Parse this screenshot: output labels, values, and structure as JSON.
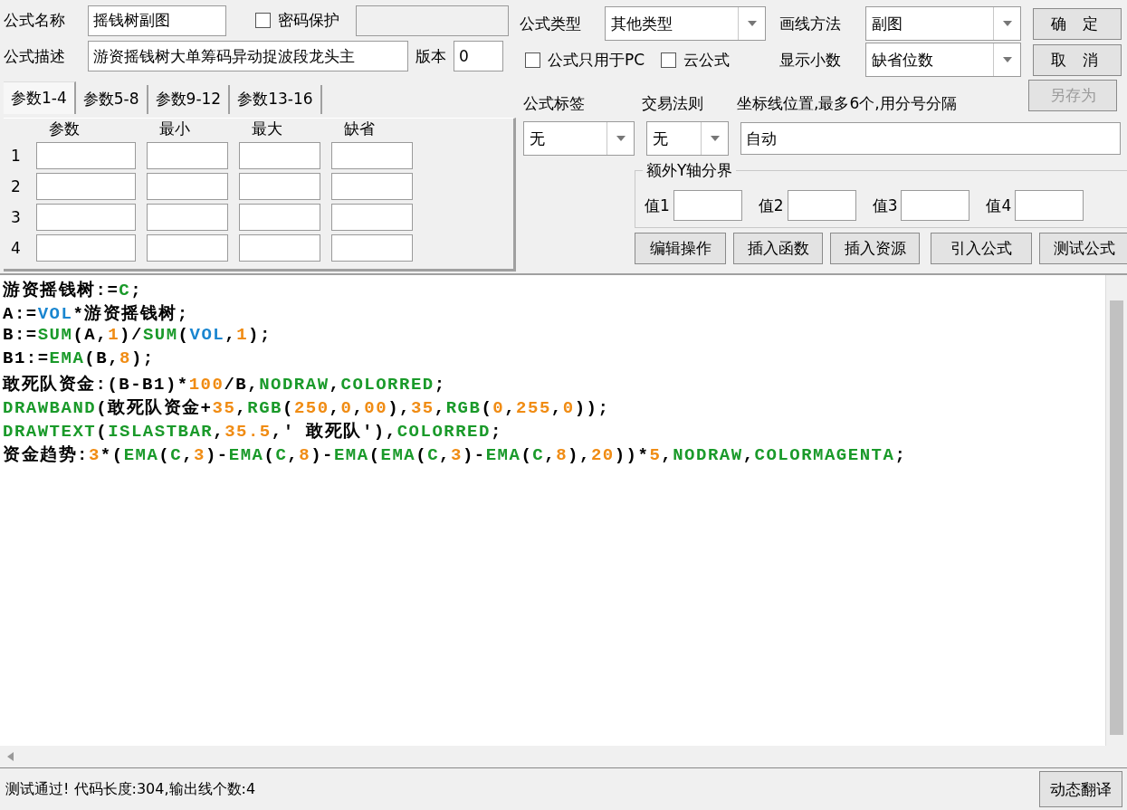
{
  "formula": {
    "name_label": "公式名称",
    "name_value": "摇钱树副图",
    "password": {
      "label": "密码保护",
      "checked": false
    },
    "password_field": {
      "disabled": true
    },
    "description_label": "公式描述",
    "description_value": "游资摇钱树大单筹码异动捉波段龙头主",
    "version_label": "版本",
    "version_value": "0"
  },
  "tabs": [
    {
      "label": "参数1-4",
      "selected": true
    },
    {
      "label": "参数5-8",
      "selected": false
    },
    {
      "label": "参数9-12",
      "selected": false
    },
    {
      "label": "参数13-16",
      "selected": false
    }
  ],
  "param_table": {
    "columns": [
      "参数",
      "最小",
      "最大",
      "缺省"
    ],
    "rows": [
      "1",
      "2",
      "3",
      "4"
    ]
  },
  "type_label": "公式类型",
  "type_value": "其他类型",
  "draw_label": "画线方法",
  "draw_value": "副图",
  "options": [
    {
      "label": "公式只用于PC",
      "checked": false
    },
    {
      "label": "云公式",
      "checked": false
    }
  ],
  "decimals_label": "显示小数",
  "decimals_value": "缺省位数",
  "dialog_buttons": [
    {
      "label": "确 定",
      "disabled": false
    },
    {
      "label": "取 消",
      "disabled": false
    },
    {
      "label": "另存为",
      "disabled": true
    }
  ],
  "tag_label": "公式标签",
  "tag_value": "无",
  "rule_label": "交易法则",
  "rule_value": "无",
  "axis_label": "坐标线位置,最多6个,用分号分隔",
  "axis_value": "自动",
  "extra_axis": {
    "title": "额外Y轴分界",
    "fields": [
      "值1",
      "值2",
      "值3",
      "值4"
    ]
  },
  "tool_buttons": [
    "编辑操作",
    "插入函数",
    "插入资源",
    "引入公式",
    "测试公式"
  ],
  "code_lines": [
    {
      "tokens": [
        {
          "kind": "plain",
          "text": "游资摇钱树:="
        },
        {
          "kind": "func",
          "text": "C"
        },
        {
          "kind": "plain",
          "text": ";"
        }
      ]
    },
    {
      "tokens": [
        {
          "kind": "plain",
          "text": "A:="
        },
        {
          "kind": "var",
          "text": "VOL"
        },
        {
          "kind": "plain",
          "text": "*游资摇钱树;"
        }
      ]
    },
    {
      "tokens": [
        {
          "kind": "plain",
          "text": "B:="
        },
        {
          "kind": "func",
          "text": "SUM"
        },
        {
          "kind": "plain",
          "text": "(A,"
        },
        {
          "kind": "num",
          "text": "1"
        },
        {
          "kind": "plain",
          "text": ")/"
        },
        {
          "kind": "func",
          "text": "SUM"
        },
        {
          "kind": "plain",
          "text": "("
        },
        {
          "kind": "var",
          "text": "VOL"
        },
        {
          "kind": "plain",
          "text": ","
        },
        {
          "kind": "num",
          "text": "1"
        },
        {
          "kind": "plain",
          "text": ");"
        }
      ]
    },
    {
      "tokens": [
        {
          "kind": "plain",
          "text": "B1:="
        },
        {
          "kind": "func",
          "text": "EMA"
        },
        {
          "kind": "plain",
          "text": "(B,"
        },
        {
          "kind": "num",
          "text": "8"
        },
        {
          "kind": "plain",
          "text": ");"
        }
      ]
    },
    {
      "tokens": [
        {
          "kind": "plain",
          "text": "敢死队资金:(B-B1)*"
        },
        {
          "kind": "num",
          "text": "100"
        },
        {
          "kind": "plain",
          "text": "/B,"
        },
        {
          "kind": "func",
          "text": "NODRAW"
        },
        {
          "kind": "plain",
          "text": ","
        },
        {
          "kind": "func",
          "text": "COLORRED"
        },
        {
          "kind": "plain",
          "text": ";"
        }
      ]
    },
    {
      "tokens": [
        {
          "kind": "func",
          "text": "DRAWBAND"
        },
        {
          "kind": "plain",
          "text": "(敢死队资金+"
        },
        {
          "kind": "num",
          "text": "35"
        },
        {
          "kind": "plain",
          "text": ","
        },
        {
          "kind": "func",
          "text": "RGB"
        },
        {
          "kind": "plain",
          "text": "("
        },
        {
          "kind": "num",
          "text": "250"
        },
        {
          "kind": "plain",
          "text": ","
        },
        {
          "kind": "num",
          "text": "0"
        },
        {
          "kind": "plain",
          "text": ","
        },
        {
          "kind": "num",
          "text": "00"
        },
        {
          "kind": "plain",
          "text": "),"
        },
        {
          "kind": "num",
          "text": "35"
        },
        {
          "kind": "plain",
          "text": ","
        },
        {
          "kind": "func",
          "text": "RGB"
        },
        {
          "kind": "plain",
          "text": "("
        },
        {
          "kind": "num",
          "text": "0"
        },
        {
          "kind": "plain",
          "text": ","
        },
        {
          "kind": "num",
          "text": "255"
        },
        {
          "kind": "plain",
          "text": ","
        },
        {
          "kind": "num",
          "text": "0"
        },
        {
          "kind": "plain",
          "text": "));"
        }
      ]
    },
    {
      "tokens": [
        {
          "kind": "func",
          "text": "DRAWTEXT"
        },
        {
          "kind": "plain",
          "text": "("
        },
        {
          "kind": "func",
          "text": "ISLASTBAR"
        },
        {
          "kind": "plain",
          "text": ","
        },
        {
          "kind": "num",
          "text": "35.5"
        },
        {
          "kind": "plain",
          "text": ",' 敢死队'),"
        },
        {
          "kind": "func",
          "text": "COLORRED"
        },
        {
          "kind": "plain",
          "text": ";"
        }
      ]
    },
    {
      "tokens": [
        {
          "kind": "plain",
          "text": "资金趋势:"
        },
        {
          "kind": "num",
          "text": "3"
        },
        {
          "kind": "plain",
          "text": "*("
        },
        {
          "kind": "func",
          "text": "EMA"
        },
        {
          "kind": "plain",
          "text": "("
        },
        {
          "kind": "func",
          "text": "C"
        },
        {
          "kind": "plain",
          "text": ","
        },
        {
          "kind": "num",
          "text": "3"
        },
        {
          "kind": "plain",
          "text": ")-"
        },
        {
          "kind": "func",
          "text": "EMA"
        },
        {
          "kind": "plain",
          "text": "("
        },
        {
          "kind": "func",
          "text": "C"
        },
        {
          "kind": "plain",
          "text": ","
        },
        {
          "kind": "num",
          "text": "8"
        },
        {
          "kind": "plain",
          "text": ")-"
        },
        {
          "kind": "func",
          "text": "EMA"
        },
        {
          "kind": "plain",
          "text": "("
        },
        {
          "kind": "func",
          "text": "EMA"
        },
        {
          "kind": "plain",
          "text": "("
        },
        {
          "kind": "func",
          "text": "C"
        },
        {
          "kind": "plain",
          "text": ","
        },
        {
          "kind": "num",
          "text": "3"
        },
        {
          "kind": "plain",
          "text": ")-"
        },
        {
          "kind": "func",
          "text": "EMA"
        },
        {
          "kind": "plain",
          "text": "("
        },
        {
          "kind": "func",
          "text": "C"
        },
        {
          "kind": "plain",
          "text": ","
        },
        {
          "kind": "num",
          "text": "8"
        },
        {
          "kind": "plain",
          "text": "),"
        },
        {
          "kind": "num",
          "text": "20"
        },
        {
          "kind": "plain",
          "text": "))*"
        },
        {
          "kind": "num",
          "text": "5"
        },
        {
          "kind": "plain",
          "text": ","
        },
        {
          "kind": "func",
          "text": "NODRAW"
        },
        {
          "kind": "plain",
          "text": ","
        },
        {
          "kind": "func",
          "text": "COLORMAGENTA"
        },
        {
          "kind": "plain",
          "text": ";"
        }
      ]
    }
  ],
  "status": {
    "text": "测试通过! 代码长度:304,输出线个数:4",
    "button": "动态翻译"
  }
}
